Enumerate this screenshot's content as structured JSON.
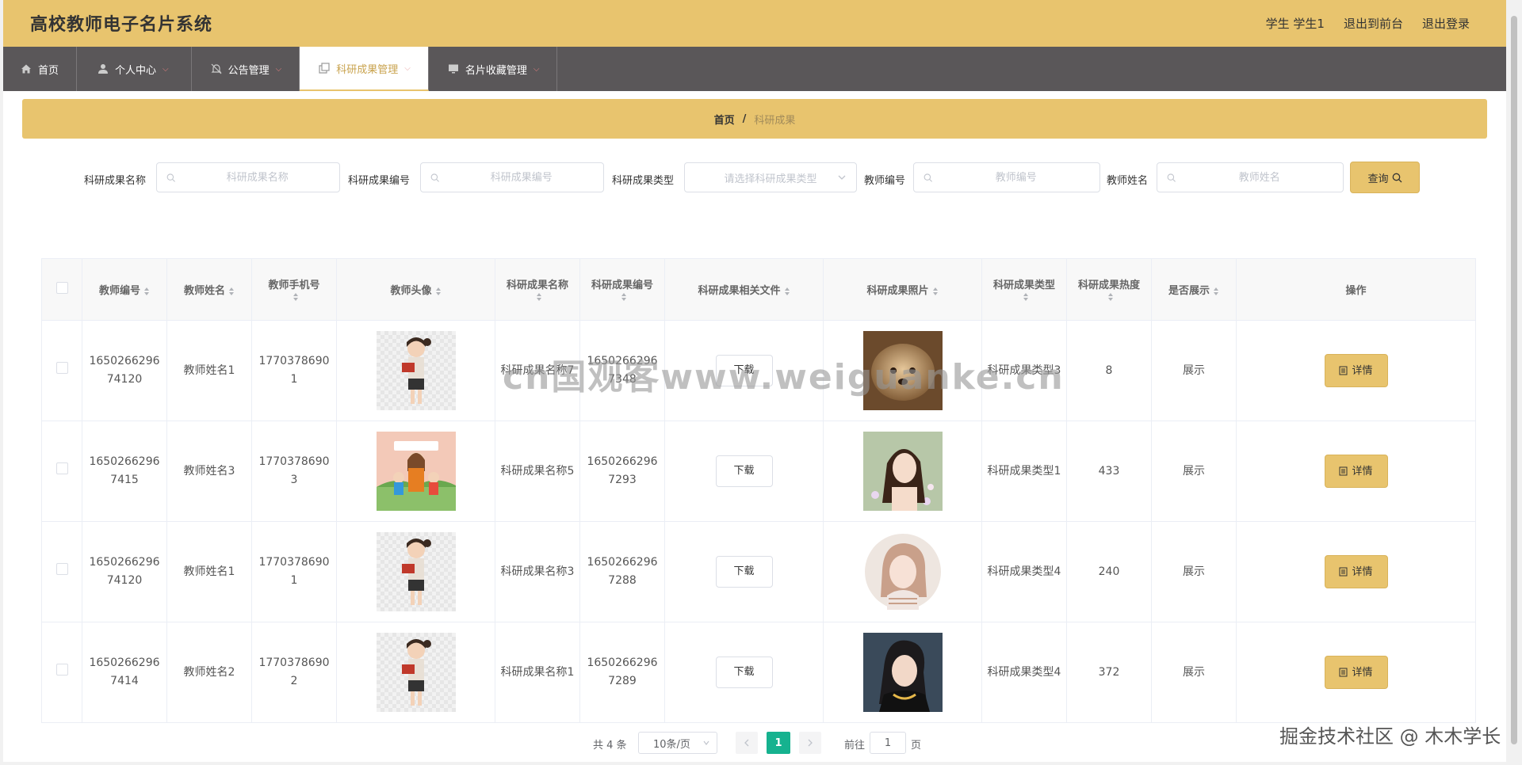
{
  "header": {
    "title": "高校教师电子名片系统",
    "user": "学生 学生1",
    "to_front": "退出到前台",
    "logout": "退出登录"
  },
  "nav": [
    {
      "label": "首页",
      "icon": "home-icon",
      "dropdown": false
    },
    {
      "label": "个人中心",
      "icon": "user-icon",
      "dropdown": true
    },
    {
      "label": "公告管理",
      "icon": "bell-off-icon",
      "dropdown": true
    },
    {
      "label": "科研成果管理",
      "icon": "copy-icon",
      "dropdown": true,
      "active": true
    },
    {
      "label": "名片收藏管理",
      "icon": "monitor-icon",
      "dropdown": true
    }
  ],
  "breadcrumb": {
    "home": "首页",
    "separator": "/",
    "current": "科研成果"
  },
  "search": {
    "name_label": "科研成果名称",
    "name_placeholder": "科研成果名称",
    "code_label": "科研成果编号",
    "code_placeholder": "科研成果编号",
    "type_label": "科研成果类型",
    "type_placeholder": "请选择科研成果类型",
    "teacher_code_label": "教师编号",
    "teacher_code_placeholder": "教师编号",
    "teacher_name_label": "教师姓名",
    "teacher_name_placeholder": "教师姓名",
    "query_label": "查询"
  },
  "table": {
    "headers": [
      "教师编号",
      "教师姓名",
      "教师手机号",
      "教师头像",
      "科研成果名称",
      "科研成果编号",
      "科研成果相关文件",
      "科研成果照片",
      "科研成果类型",
      "科研成果热度",
      "是否展示",
      "操作"
    ],
    "download_label": "下载",
    "detail_label": "详情",
    "rows": [
      {
        "teacher_code": "165026629674120",
        "teacher_name": "教师姓名1",
        "phone": "17703786901",
        "avatar": "teacher-reading",
        "name": "科研成果名称7",
        "code": "16502662967348",
        "photo": "puppy",
        "type": "科研成果类型3",
        "heat": "8",
        "show": "展示"
      },
      {
        "teacher_code": "16502662967415",
        "teacher_name": "教师姓名3",
        "phone": "17703786903",
        "avatar": "teacher-children",
        "name": "科研成果名称5",
        "code": "16502662967293",
        "photo": "woman-flowers",
        "type": "科研成果类型1",
        "heat": "433",
        "show": "展示"
      },
      {
        "teacher_code": "165026629674120",
        "teacher_name": "教师姓名1",
        "phone": "17703786901",
        "avatar": "teacher-reading",
        "name": "科研成果名称3",
        "code": "16502662967288",
        "photo": "girl-illustration",
        "type": "科研成果类型4",
        "heat": "240",
        "show": "展示"
      },
      {
        "teacher_code": "16502662967414",
        "teacher_name": "教师姓名2",
        "phone": "17703786902",
        "avatar": "teacher-reading",
        "name": "科研成果名称1",
        "code": "16502662967289",
        "photo": "woman-dark",
        "type": "科研成果类型4",
        "heat": "372",
        "show": "展示"
      }
    ]
  },
  "pagination": {
    "total": "共 4 条",
    "page_size": "10条/页",
    "current": "1",
    "goto": "前往",
    "goto_value": "1",
    "page_unit": "页"
  },
  "watermarks": {
    "center": "cn国观客www.weiguanke.cn",
    "bottom": "掘金技术社区 @ 木木学长"
  },
  "colors": {
    "accent": "#e8c46e",
    "nav_bg": "#5a5759",
    "pager_active": "#16b28f"
  }
}
